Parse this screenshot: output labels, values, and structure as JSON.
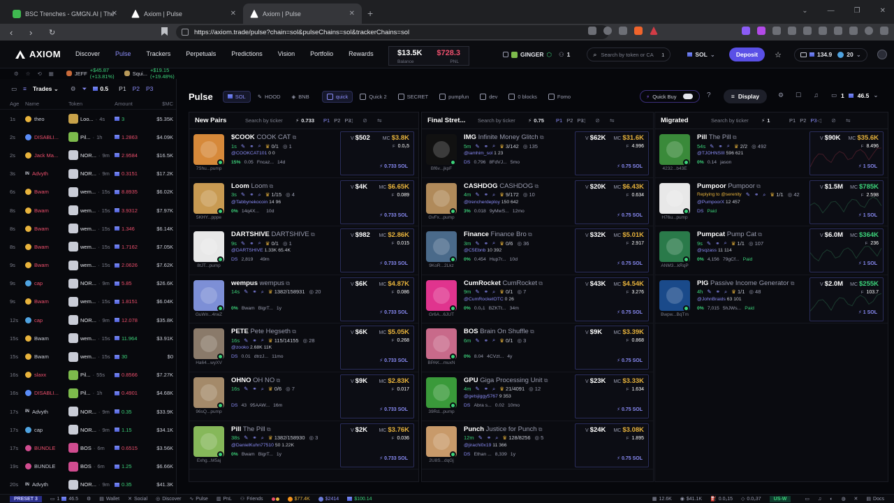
{
  "browser": {
    "tabs": [
      {
        "title": "BSC Trenches - GMGN.AI | The Fastest",
        "color": "#3fb950"
      },
      {
        "title": "Axiom | Pulse",
        "color": "#e4e6ec"
      },
      {
        "title": "Axiom | Pulse",
        "color": "#e4e6ec",
        "active": true
      }
    ],
    "url": "https://axiom.trade/pulse?chain=sol&pulseChains=sol&trackerChains=sol"
  },
  "header": {
    "logo": "AXIOM",
    "nav": [
      "Discover",
      "Pulse",
      "Trackers",
      "Perpetuals",
      "Predictions",
      "Vision",
      "Portfolio",
      "Rewards"
    ],
    "active_nav": "Pulse",
    "balance": "$13.5K",
    "pnl": "$728.3",
    "balance_label": "Balance",
    "pnl_label": "PNL",
    "user": "GINGER",
    "user_count": "1",
    "search_placeholder": "Search by token or CA",
    "search_count": "1",
    "chain": "SOL",
    "deposit": "Deposit",
    "wallet_value": "134.9",
    "wallet_count": "20"
  },
  "ticker": [
    {
      "name": "JEFF",
      "change": "+$45.87 (+13.81%)"
    },
    {
      "name": "Squi...",
      "change": "+$19.15 (+19.48%)"
    }
  ],
  "sidebar": {
    "trades_label": "Trades",
    "amount_filter": "0.5",
    "presets": [
      "P1",
      "P2",
      "P3"
    ],
    "columns": [
      "Age",
      "Name",
      "Token",
      "Amount",
      "$MC"
    ],
    "rows": [
      {
        "age": "1s",
        "name": "theo",
        "tag": "bot",
        "token": "Loo...",
        "tage": "4s",
        "amt": "3",
        "mc": "$5.35K",
        "red": false,
        "tc": "#c8a24a"
      },
      {
        "age": "2s",
        "name": "DISABLI...",
        "tag": "x",
        "token": "Pil...",
        "tage": "1h",
        "amt": "1.2863",
        "mc": "$4.09K",
        "red": true,
        "tc": "#7dbb4c"
      },
      {
        "age": "2s",
        "name": "Jack Ma...",
        "tag": "bot",
        "token": "NOR...",
        "tage": "9m",
        "amt": "2.9584",
        "mc": "$16.5K",
        "red": true,
        "tc": "#c9ccd6"
      },
      {
        "age": "3s",
        "name": "Advyth",
        "tag": "IN",
        "token": "NOR...",
        "tage": "9m",
        "amt": "0.3151",
        "mc": "$17.2K",
        "red": true,
        "tc": "#c9ccd6"
      },
      {
        "age": "6s",
        "name": "Bwam",
        "tag": "bot",
        "token": "wem...",
        "tage": "15s",
        "amt": "8.8935",
        "mc": "$6.02K",
        "red": true,
        "tc": "#c9ccd6"
      },
      {
        "age": "8s",
        "name": "Bwam",
        "tag": "bot",
        "token": "wem...",
        "tage": "15s",
        "amt": "3.9312",
        "mc": "$7.97K",
        "red": true,
        "tc": "#c9ccd6"
      },
      {
        "age": "8s",
        "name": "Bwam",
        "tag": "bot",
        "token": "wem...",
        "tage": "15s",
        "amt": "1.346",
        "mc": "$6.14K",
        "red": true,
        "tc": "#c9ccd6"
      },
      {
        "age": "8s",
        "name": "Bwam",
        "tag": "bot",
        "token": "wem...",
        "tage": "15s",
        "amt": "1.7162",
        "mc": "$7.05K",
        "red": true,
        "tc": "#c9ccd6"
      },
      {
        "age": "9s",
        "name": "Bwam",
        "tag": "bot",
        "token": "wem...",
        "tage": "15s",
        "amt": "2.0626",
        "mc": "$7.62K",
        "red": true,
        "tc": "#c9ccd6"
      },
      {
        "age": "9s",
        "name": "cap",
        "tag": "fish",
        "token": "NOR...",
        "tage": "9m",
        "amt": "5.85",
        "mc": "$26.6K",
        "red": true,
        "tc": "#c9ccd6"
      },
      {
        "age": "9s",
        "name": "Bwam",
        "tag": "bot",
        "token": "wem...",
        "tage": "15s",
        "amt": "1.8151",
        "mc": "$6.04K",
        "red": true,
        "tc": "#c9ccd6"
      },
      {
        "age": "12s",
        "name": "cap",
        "tag": "fish",
        "token": "NOR...",
        "tage": "9m",
        "amt": "12.078",
        "mc": "$35.8K",
        "red": true,
        "tc": "#c9ccd6"
      },
      {
        "age": "15s",
        "name": "Bwam",
        "tag": "bot",
        "token": "wem...",
        "tage": "15s",
        "amt": "11.964",
        "mc": "$3.91K",
        "red": false,
        "tc": "#c9ccd6"
      },
      {
        "age": "15s",
        "name": "Bwam",
        "tag": "bot",
        "token": "wem...",
        "tage": "15s",
        "amt": "30",
        "mc": "$0",
        "red": false,
        "tc": "#c9ccd6"
      },
      {
        "age": "16s",
        "name": "slaxx",
        "tag": "bot",
        "token": "Pil...",
        "tage": "55s",
        "amt": "0.8566",
        "mc": "$7.27K",
        "red": true,
        "tc": "#7dbb4c"
      },
      {
        "age": "16s",
        "name": "DISABLI...",
        "tag": "x",
        "token": "Pil...",
        "tage": "1h",
        "amt": "0.4901",
        "mc": "$4.68K",
        "red": true,
        "tc": "#7dbb4c"
      },
      {
        "age": "17s",
        "name": "Advyth",
        "tag": "IN",
        "token": "NOR...",
        "tage": "9m",
        "amt": "0.35",
        "mc": "$33.9K",
        "red": false,
        "tc": "#c9ccd6"
      },
      {
        "age": "17s",
        "name": "cap",
        "tag": "fish",
        "token": "NOR...",
        "tage": "9m",
        "amt": "1.15",
        "mc": "$34.1K",
        "red": false,
        "tc": "#c9ccd6"
      },
      {
        "age": "17s",
        "name": "BUNDLE",
        "tag": "bundle",
        "token": "BOS",
        "tage": "6m",
        "amt": "0.6515",
        "mc": "$3.56K",
        "red": true,
        "tc": "#d04c8f"
      },
      {
        "age": "19s",
        "name": "BUNDLE",
        "tag": "bundle",
        "token": "BOS",
        "tage": "6m",
        "amt": "1.25",
        "mc": "$6.66K",
        "red": false,
        "tc": "#d04c8f"
      },
      {
        "age": "20s",
        "name": "Advyth",
        "tag": "IN",
        "token": "NOR...",
        "tage": "9m",
        "amt": "0.35",
        "mc": "$41.3K",
        "red": false,
        "tc": "#c9ccd6"
      }
    ]
  },
  "pulse": {
    "title": "Pulse",
    "chains": [
      "SOL",
      "HOOD",
      "BNB"
    ],
    "tabs": [
      "quick",
      "Quick 2",
      "SECRET",
      "pumpfun",
      "dev",
      "0 blocks",
      "Fomo"
    ],
    "quick_buy": "Quick Buy",
    "display": "Display",
    "right_count": "1",
    "right_amount": "46.5"
  },
  "columns": [
    {
      "title": "New Pairs",
      "search": "Search by ticker",
      "bolt": "0.733",
      "presets": [
        "P1",
        "P2",
        "P3"
      ],
      "cards": [
        {
          "ticker": "$COOK",
          "name": "COOK CAT",
          "addr": "7Shu...pump",
          "age": "1s",
          "holders": "0/1",
          "count": "1",
          "handle": "@COOKCAT101",
          "h1": "0",
          "h2": "0",
          "pct": "15%",
          "r4a": "0.05",
          "r4b": "Fncaz...",
          "r4c": "14d",
          "v": "$502",
          "mc": "$3.8K",
          "f": "0.0₂5",
          "sol": "0.733 SOL",
          "mcg": false,
          "img": "#d6893a"
        },
        {
          "ticker": "Loom",
          "name": "Loom",
          "addr": "5KHY...pppe",
          "age": "3s",
          "holders": "1/15",
          "count": "4",
          "handle": "@Tabbynekocoin",
          "h1": "14",
          "h2": "96",
          "pct": "0%",
          "r4a": "14q4X...",
          "r4b": "",
          "r4c": "10d",
          "v": "$4K",
          "mc": "$6.65K",
          "f": "0.089",
          "sol": "0.733 SOL",
          "mcg": false,
          "img": "#c89a52"
        },
        {
          "ticker": "DARTSHIVE",
          "name": "DARTSHIVE",
          "addr": "8tJT...pump",
          "age": "9s",
          "holders": "0/1",
          "count": "1",
          "handle": "@DARTSHIVE",
          "h1": "1.33K",
          "h2": "65.4K",
          "pct": "DS",
          "r4a": "2,819",
          "r4b": "",
          "r4c": "49m",
          "v": "$982",
          "mc": "$2.86K",
          "f": "0.015",
          "sol": "0.733 SOL",
          "mcg": false,
          "img": "#e8e8e8"
        },
        {
          "ticker": "wempus",
          "name": "wempus",
          "addr": "GuWn...4rwZ",
          "age": "14s",
          "holders": "1382/158931",
          "count": "20",
          "handle": "",
          "h1": "",
          "h2": "",
          "pct": "0%",
          "r4a": "Bwam",
          "r4b": "BigrT...",
          "r4c": "1y",
          "v": "$6K",
          "mc": "$4.87K",
          "f": "0.086",
          "sol": "0.733 SOL",
          "mcg": false,
          "img": "#7d8fd6"
        },
        {
          "ticker": "PETE",
          "name": "Pete Hegseth",
          "addr": "Ha64...wyXV",
          "age": "16s",
          "holders": "115/14155",
          "count": "28",
          "handle": "@zooko",
          "h1": "2.68K",
          "h2": "11K",
          "pct": "DS",
          "r4a": "0.01",
          "r4b": "dtrzJ...",
          "r4c": "11mo",
          "v": "$6K",
          "mc": "$5.05K",
          "f": "0.268",
          "sol": "0.733 SOL",
          "mcg": false,
          "img": "#8a7a6a"
        },
        {
          "ticker": "OHNO",
          "name": "OH NO",
          "addr": "96sQ...pump",
          "age": "16s",
          "holders": "0/6",
          "count": "7",
          "handle": "",
          "h1": "",
          "h2": "",
          "pct": "DS",
          "r4a": "43",
          "r4b": "95AAW...",
          "r4c": "16m",
          "v": "$9K",
          "mc": "$2.83K",
          "f": "0.017",
          "sol": "0.733 SOL",
          "mcg": false,
          "img": "#a48a6a"
        },
        {
          "ticker": "Pill",
          "name": "The Pill",
          "addr": "Exhg...M5aj",
          "age": "38s",
          "holders": "1382/158930",
          "count": "3",
          "handle": "@DanielKuhn77510",
          "h1": "50",
          "h2": "1.22K",
          "pct": "0%",
          "r4a": "Bwam",
          "r4b": "BigrT...",
          "r4c": "1y",
          "v": "$2K",
          "mc": "$3.76K",
          "f": "0.036",
          "sol": "0.733 SOL",
          "mcg": false,
          "img": "#86b85a"
        }
      ]
    },
    {
      "title": "Final Stret...",
      "search": "Search by ticker",
      "bolt": "0.75",
      "presets": [
        "P1",
        "P2",
        "P3"
      ],
      "cards": [
        {
          "ticker": "IMG",
          "name": "Infinite Money Glitch",
          "addr": "Bf6v...jkpF",
          "age": "5m",
          "holders": "3/142",
          "count": "135",
          "handle": "@iamhim_sol",
          "h1": "1",
          "h2": "23",
          "pct": "DS",
          "r4a": "0.796",
          "r4b": "8FdVJ...",
          "r4c": "5mo",
          "v": "$62K",
          "mc": "$31.6K",
          "f": "4.996",
          "sol": "0.75 SOL",
          "mcg": false,
          "img": "#111111"
        },
        {
          "ticker": "CASHDOG",
          "name": "CASHDOG",
          "addr": "GvFx...pump",
          "age": "4m",
          "holders": "9/172",
          "count": "10",
          "handle": "@trencherdeploy",
          "h1": "150",
          "h2": "642",
          "pct": "3%",
          "r4a": "0.018",
          "r4b": "9yMwS...",
          "r4c": "12mo",
          "v": "$20K",
          "mc": "$6.43K",
          "f": "0.634",
          "sol": "0.75 SOL",
          "mcg": false,
          "img": "#b08a5a"
        },
        {
          "ticker": "Finance",
          "name": "Finance Bro",
          "addr": "9KoR...2Lkz",
          "age": "3m",
          "holders": "0/6",
          "count": "36",
          "handle": "@C5Ebnb",
          "h1": "10",
          "h2": "392",
          "pct": "0%",
          "r4a": "0.454",
          "r4b": "Hup7r...",
          "r4c": "10d",
          "v": "$32K",
          "mc": "$5.01K",
          "f": "2.917",
          "sol": "0.75 SOL",
          "mcg": false,
          "img": "#4a6a8a"
        },
        {
          "ticker": "CumRocket",
          "name": "CumRocket",
          "addr": "Gr6A...6JUT",
          "age": "9m",
          "holders": "0/1",
          "count": "7",
          "handle": "@CumRocketOTC",
          "h1": "0",
          "h2": "26",
          "pct": "0%",
          "r4a": "0.0₂1",
          "r4b": "BZKTt...",
          "r4c": "34m",
          "v": "$43K",
          "mc": "$4.54K",
          "f": "3.276",
          "sol": "0.75 SOL",
          "mcg": false,
          "img": "#e0348e"
        },
        {
          "ticker": "BOS",
          "name": "Brain On Shuffle",
          "addr": "BPAK...muxN",
          "age": "6m",
          "holders": "0/1",
          "count": "3",
          "handle": "",
          "h1": "",
          "h2": "",
          "pct": "0%",
          "r4a": "8.04",
          "r4b": "4CVzt...",
          "r4c": "4y",
          "v": "$9K",
          "mc": "$3.39K",
          "f": "0.868",
          "sol": "0.75 SOL",
          "mcg": false,
          "img": "#c86a8a"
        },
        {
          "ticker": "GPU",
          "name": "Giga Processing Unit",
          "addr": "39Rd...pump",
          "age": "4m",
          "holders": "21/4091",
          "count": "12",
          "handle": "@getsjiggy5767",
          "h1": "9",
          "h2": "353",
          "pct": "DS",
          "r4a": "Abra s...",
          "r4b": "0.02",
          "r4c": "10mo",
          "v": "$23K",
          "mc": "$3.33K",
          "f": "1.634",
          "sol": "0.75 SOL",
          "mcg": false,
          "img": "#3a9a3a"
        },
        {
          "ticker": "Punch",
          "name": "Justice for Punch",
          "addr": "2U8S...dqGj",
          "age": "12m",
          "holders": "128/8256",
          "count": "5",
          "handle": "@jirachi0x19",
          "h1": "11",
          "h2": "366",
          "pct": "DS",
          "r4a": "Ethan ...",
          "r4b": "8,339",
          "r4c": "1y",
          "v": "$24K",
          "mc": "$3.08K",
          "f": "1.895",
          "sol": "0.75 SOL",
          "mcg": false,
          "img": "#c89a6a"
        }
      ]
    },
    {
      "title": "Migrated",
      "search": "Search by ticker",
      "bolt": "1",
      "presets": [
        "P1",
        "P2",
        "P3"
      ],
      "cards": [
        {
          "ticker": "Pill",
          "name": "The Pill",
          "addr": "4232...b43E",
          "age": "54s",
          "holders": "2/2",
          "count": "492",
          "handle": "@TJOHNSIII",
          "h1": "596",
          "h2": "621",
          "pct": "0%",
          "r4a": "0.14",
          "r4b": "jason",
          "r4c": "",
          "v": "$90K",
          "mc": "$35.6K",
          "f": "8.496",
          "sol": "1 SOL",
          "mcg": false,
          "img": "#3a8a3a"
        },
        {
          "ticker": "Pumpoor",
          "name": "Pumpoor",
          "addr": "H76u...pump",
          "age": "Replying to @serenity",
          "holders": "1/1",
          "count": "42",
          "handle": "@PumpoorX",
          "h1": "12",
          "h2": "457",
          "pct": "DS",
          "r4a": "Paid",
          "r4b": "",
          "r4c": "",
          "v": "$1.5M",
          "mc": "$785K",
          "f": "2.598",
          "sol": "1 SOL",
          "mcg": true,
          "img": "#e8e8e8"
        },
        {
          "ticker": "Pumpcat",
          "name": "Pump Cat",
          "addr": "ANM3...kRqP",
          "age": "9s",
          "holders": "1/1",
          "count": "107",
          "handle": "@sqzass",
          "h1": "11",
          "h2": "114",
          "pct": "0%",
          "r4a": "4,156",
          "r4b": "79gCf...",
          "r4c": "Paid",
          "v": "$6.0M",
          "mc": "$364K",
          "f": "236",
          "sol": "1 SOL",
          "mcg": true,
          "img": "#2a7a4a"
        },
        {
          "ticker": "PIG",
          "name": "Passive Income Generator",
          "addr": "Bwpw...BqTm",
          "age": "4h",
          "holders": "1/1",
          "count": "48",
          "handle": "@JohnBraids",
          "h1": "63",
          "h2": "101",
          "pct": "0%",
          "r4a": "7,015",
          "r4b": "5hJWs...",
          "r4c": "Paid",
          "v": "$2.0M",
          "mc": "$255K",
          "f": "103.7",
          "sol": "1 SOL",
          "mcg": true,
          "img": "#1a4a8a"
        }
      ]
    }
  ],
  "footer": {
    "preset": "PRESET 3",
    "count": "1",
    "amount": "46.5",
    "items": [
      "Wallet",
      "Social",
      "Discover",
      "Pulse",
      "PnL",
      "Friends"
    ],
    "prices": [
      "$77.4K",
      "$2414",
      "$100.14"
    ],
    "right": [
      "12.6K",
      "$41.1K",
      "0.0₂15",
      "0.0₂37"
    ],
    "region": "US-W",
    "docs": "Docs"
  }
}
